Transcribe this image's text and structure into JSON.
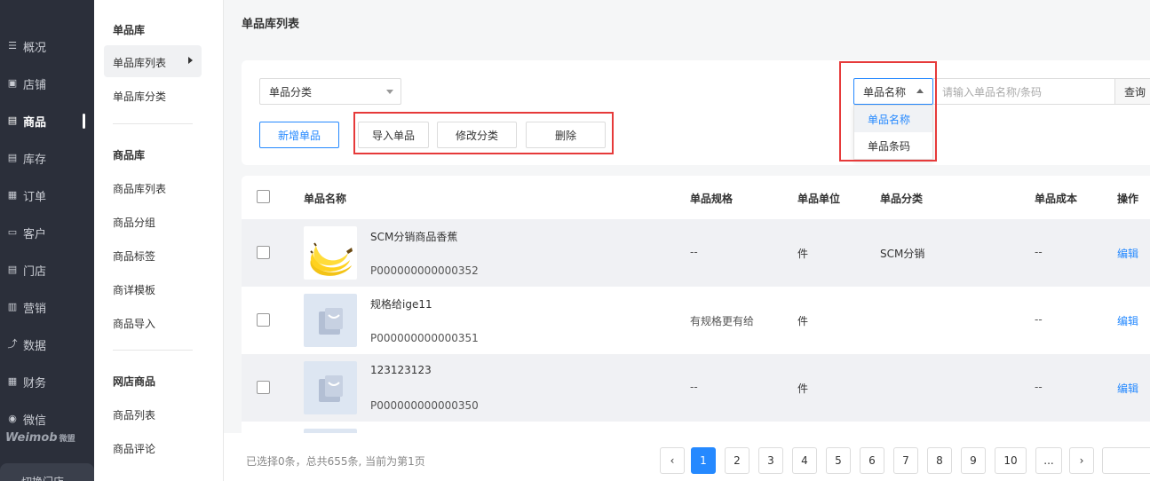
{
  "nav": {
    "items": [
      {
        "label": "概况",
        "icon": "list-icon"
      },
      {
        "label": "店铺",
        "icon": "store-icon"
      },
      {
        "label": "商品",
        "icon": "product-icon",
        "active": true
      },
      {
        "label": "库存",
        "icon": "inventory-icon"
      },
      {
        "label": "订单",
        "icon": "order-icon"
      },
      {
        "label": "客户",
        "icon": "customer-icon"
      },
      {
        "label": "门店",
        "icon": "shop-icon"
      },
      {
        "label": "营销",
        "icon": "marketing-icon"
      },
      {
        "label": "数据",
        "icon": "data-icon"
      },
      {
        "label": "财务",
        "icon": "finance-icon"
      },
      {
        "label": "微信",
        "icon": "wechat-icon"
      }
    ],
    "logo": "Weimob",
    "logo_cn": "微盟",
    "switch_label": "切换门店"
  },
  "submenu": {
    "group1_title": "单品库",
    "group1_items": [
      "单品库列表",
      "单品库分类"
    ],
    "group2_title": "商品库",
    "group2_items": [
      "商品库列表",
      "商品分组",
      "商品标签",
      "商详模板",
      "商品导入"
    ],
    "group3_title": "网店商品",
    "group3_items": [
      "商品列表",
      "商品评论"
    ]
  },
  "page_title": "单品库列表",
  "filter": {
    "category_select": "单品分类",
    "add_button": "新增单品",
    "import_button": "导入单品",
    "edit_category_button": "修改分类",
    "delete_button": "删除",
    "search_type": "单品名称",
    "search_placeholder": "请输入单品名称/条码",
    "search_button": "查询",
    "dropdown_options": [
      "单品名称",
      "单品条码"
    ]
  },
  "table": {
    "headers": [
      "单品名称",
      "单品规格",
      "单品单位",
      "单品分类",
      "单品成本",
      "操作"
    ],
    "rows": [
      {
        "name": "SCM分销商品香蕉",
        "code": "P000000000000352",
        "spec": "--",
        "unit": "件",
        "category": "SCM分销",
        "cost": "--",
        "action": "编辑",
        "thumb": "banana"
      },
      {
        "name": "规格给ige11",
        "code": "P000000000000351",
        "spec": "有规格更有给",
        "unit": "件",
        "category": "",
        "cost": "--",
        "action": "编辑",
        "thumb": "placeholder"
      },
      {
        "name": "123123123",
        "code": "P000000000000350",
        "spec": "--",
        "unit": "件",
        "category": "",
        "cost": "--",
        "action": "编辑",
        "thumb": "placeholder"
      }
    ]
  },
  "footer": {
    "info": "已选择0条，总共655条, 当前为第1页",
    "prev": "‹",
    "next": "›",
    "pages": [
      "1",
      "2",
      "3",
      "4",
      "5",
      "6",
      "7",
      "8",
      "9",
      "10",
      "..."
    ],
    "current_page": "1"
  },
  "colors": {
    "accent": "#2589ff",
    "highlight": "#e63a3a",
    "nav_bg": "#2b2f3a"
  }
}
